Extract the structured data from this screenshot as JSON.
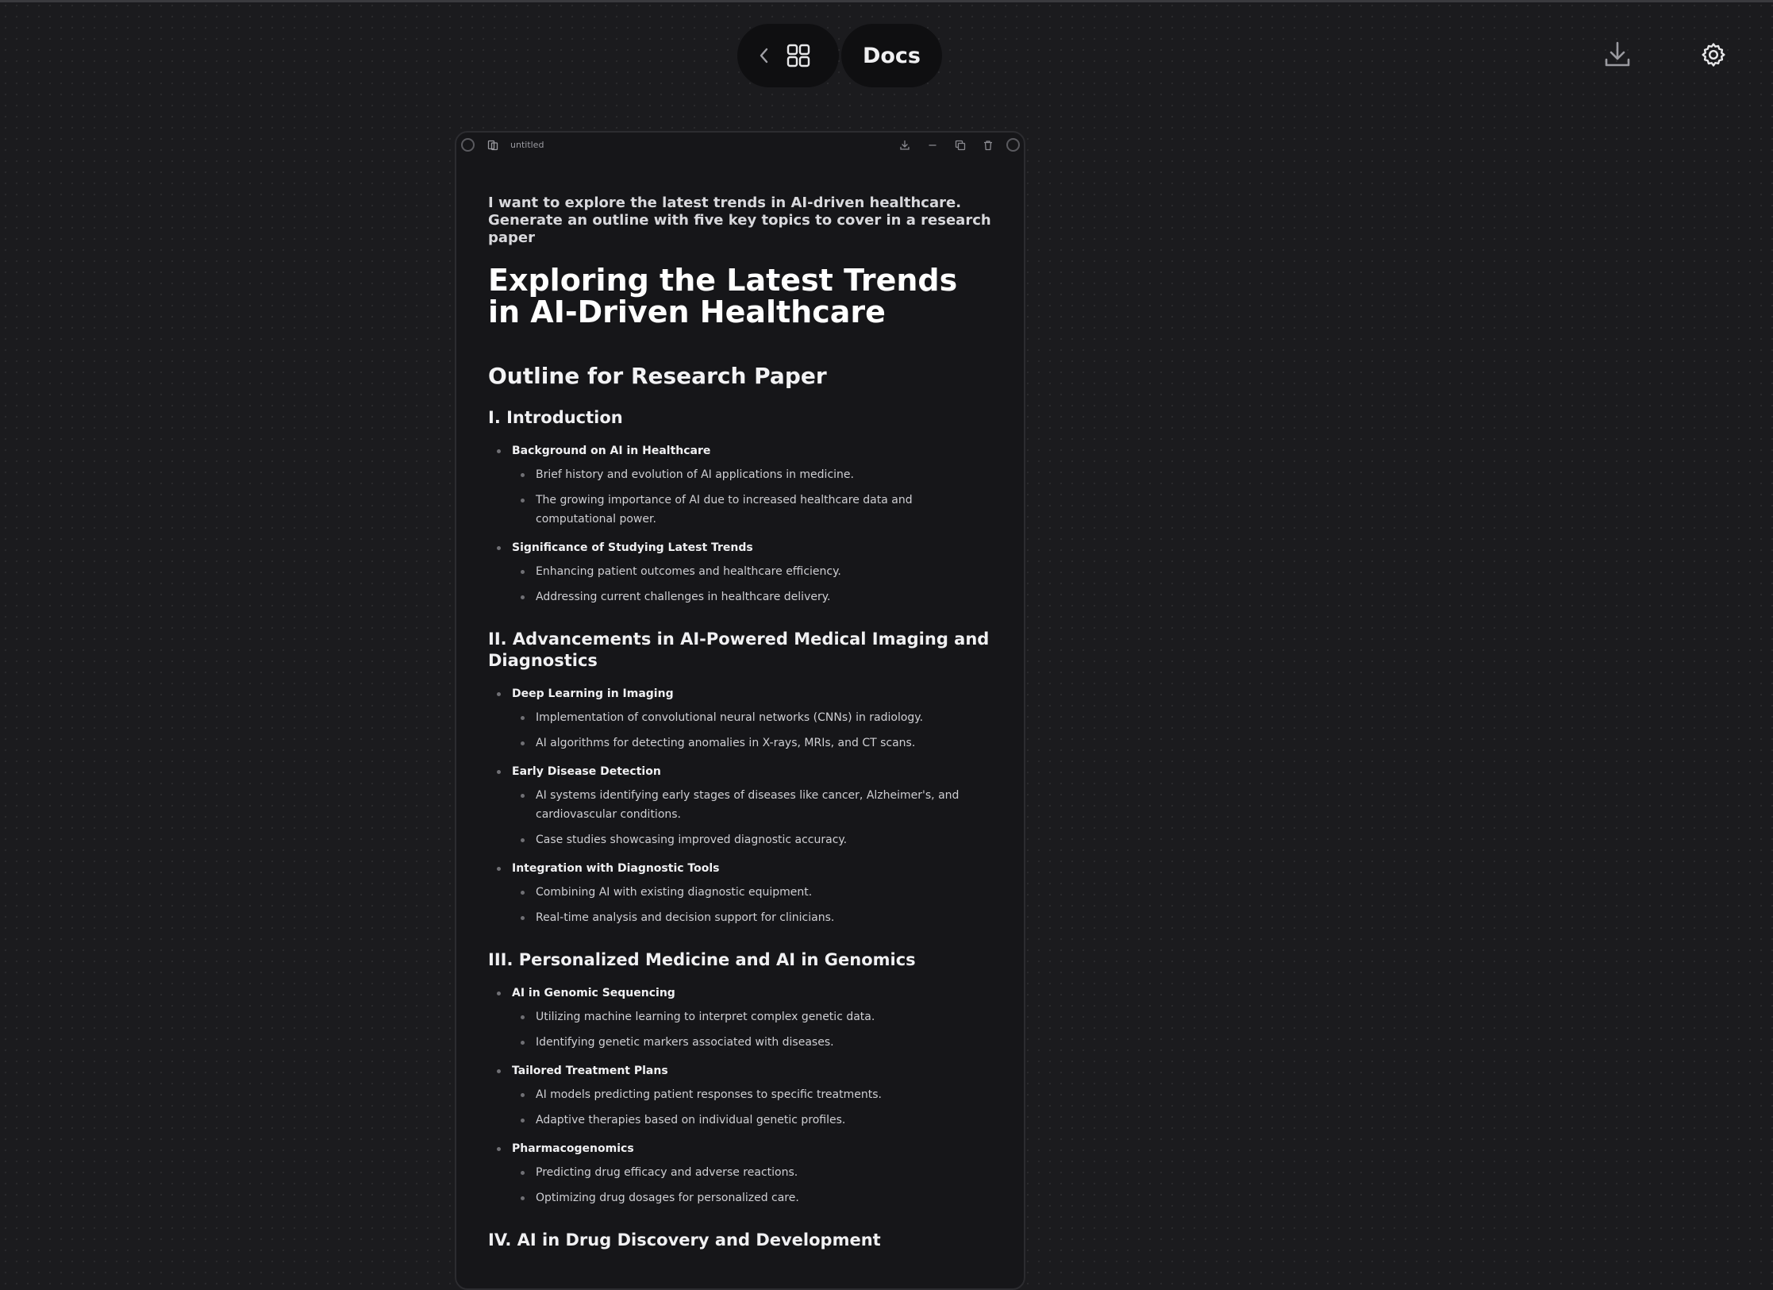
{
  "header": {
    "docs_label": "Docs"
  },
  "window": {
    "title": "untitled"
  },
  "doc": {
    "prompt": "I want to explore the latest trends in AI-driven healthcare. Generate an outline with five key topics to cover in a research paper",
    "title": "Exploring the Latest Trends in AI-Driven Healthcare",
    "subtitle": "Outline for Research Paper",
    "sections": [
      {
        "heading": "I. Introduction",
        "items": [
          {
            "title": "Background on AI in Healthcare",
            "points": [
              "Brief history and evolution of AI applications in medicine.",
              "The growing importance of AI due to increased healthcare data and computational power."
            ]
          },
          {
            "title": "Significance of Studying Latest Trends",
            "points": [
              "Enhancing patient outcomes and healthcare efficiency.",
              "Addressing current challenges in healthcare delivery."
            ]
          }
        ]
      },
      {
        "heading": "II. Advancements in AI-Powered Medical Imaging and Diagnostics",
        "items": [
          {
            "title": "Deep Learning in Imaging",
            "points": [
              "Implementation of convolutional neural networks (CNNs) in radiology.",
              "AI algorithms for detecting anomalies in X-rays, MRIs, and CT scans."
            ]
          },
          {
            "title": "Early Disease Detection",
            "points": [
              "AI systems identifying early stages of diseases like cancer, Alzheimer's, and cardiovascular conditions.",
              "Case studies showcasing improved diagnostic accuracy."
            ]
          },
          {
            "title": "Integration with Diagnostic Tools",
            "points": [
              "Combining AI with existing diagnostic equipment.",
              "Real-time analysis and decision support for clinicians."
            ]
          }
        ]
      },
      {
        "heading": "III. Personalized Medicine and AI in Genomics",
        "items": [
          {
            "title": "AI in Genomic Sequencing",
            "points": [
              "Utilizing machine learning to interpret complex genetic data.",
              "Identifying genetic markers associated with diseases."
            ]
          },
          {
            "title": "Tailored Treatment Plans",
            "points": [
              "AI models predicting patient responses to specific treatments.",
              "Adaptive therapies based on individual genetic profiles."
            ]
          },
          {
            "title": "Pharmacogenomics",
            "points": [
              "Predicting drug efficacy and adverse reactions.",
              "Optimizing drug dosages for personalized care."
            ]
          }
        ]
      },
      {
        "heading": "IV. AI in Drug Discovery and Development",
        "items": []
      }
    ]
  }
}
